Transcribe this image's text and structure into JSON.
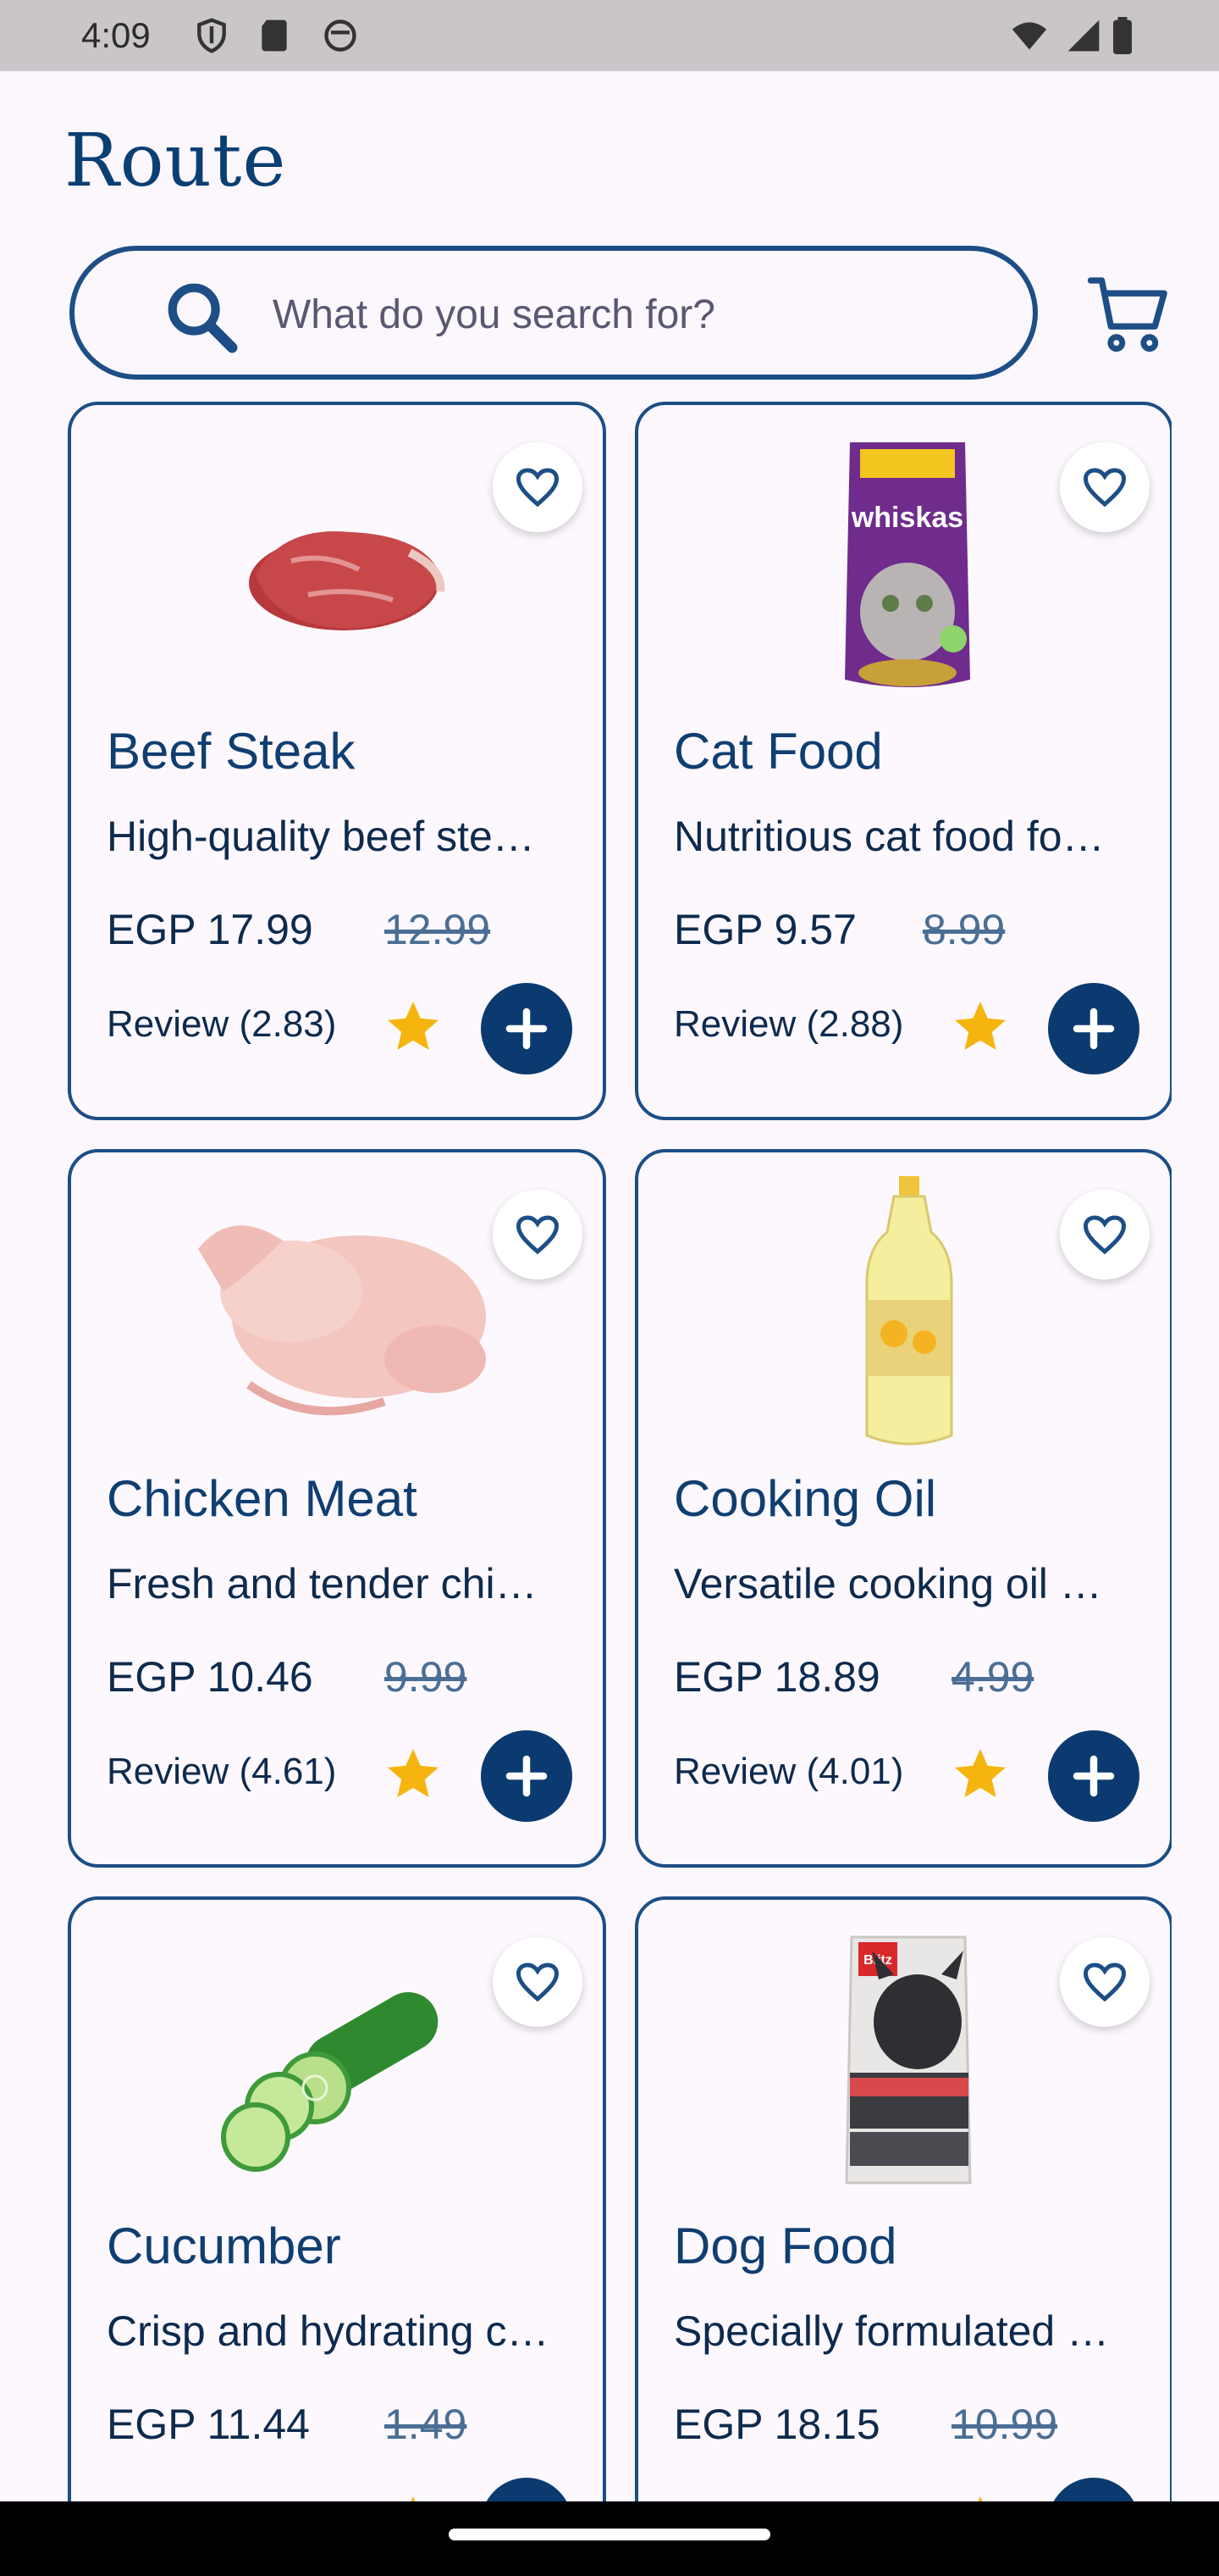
{
  "status_bar": {
    "time": "4:09",
    "icons_left": [
      "shield-icon",
      "sd-card-icon",
      "face-icon"
    ],
    "icons_right": [
      "wifi-icon",
      "signal-icon",
      "battery-icon"
    ]
  },
  "header": {
    "logo_text": "Route"
  },
  "search": {
    "placeholder": "What do you search for?",
    "icon": "search-icon"
  },
  "cart": {
    "icon": "cart-icon"
  },
  "colors": {
    "primary": "#0b3a70",
    "border": "#1d4e85",
    "star": "#f6b40e",
    "background": "#fbf7fd"
  },
  "products": [
    {
      "name": "Beef Steak",
      "description": "High-quality beef ste…",
      "price": "EGP 17.99",
      "old_price": "12.99",
      "review": "Review (2.83)",
      "image": "beef-steak-image"
    },
    {
      "name": "Cat Food",
      "description": "Nutritious cat food fo…",
      "price": "EGP 9.57",
      "old_price": "8.99",
      "review": "Review (2.88)",
      "image": "cat-food-image",
      "image_brand": "whiskas"
    },
    {
      "name": "Chicken Meat",
      "description": "Fresh and tender chi…",
      "price": "EGP 10.46",
      "old_price": "9.99",
      "review": "Review (4.61)",
      "image": "chicken-image"
    },
    {
      "name": "Cooking Oil",
      "description": "Versatile cooking oil …",
      "price": "EGP 18.89",
      "old_price": "4.99",
      "review": "Review (4.01)",
      "image": "cooking-oil-image"
    },
    {
      "name": "Cucumber",
      "description": "Crisp and hydrating c…",
      "price": "EGP 11.44",
      "old_price": "1.49",
      "review": "",
      "image": "cucumber-image"
    },
    {
      "name": "Dog Food",
      "description": "Specially formulated …",
      "price": "EGP 18.15",
      "old_price": "10.99",
      "review": "",
      "image": "dog-food-image",
      "image_brand": "Blitz"
    }
  ]
}
